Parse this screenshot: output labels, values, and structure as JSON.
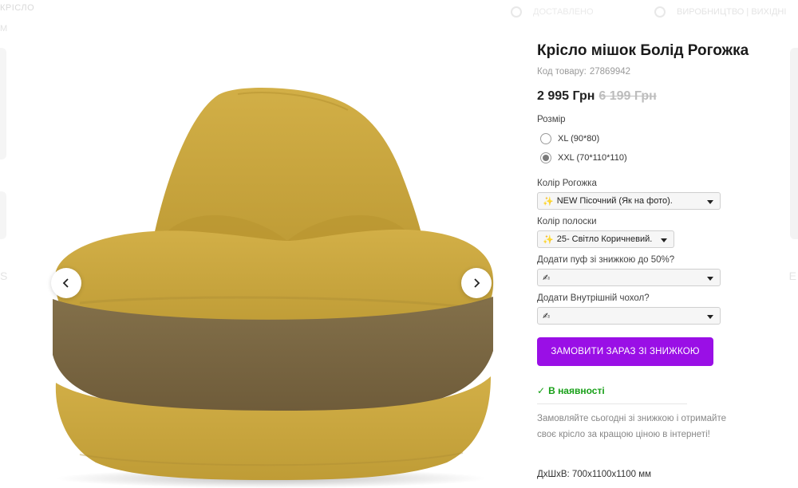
{
  "background": {
    "top_left": "КРІСЛО",
    "top_left_2": "М",
    "top_mid": "ДОСТАВЛЕНО",
    "top_right": "ВИРОБНИЦТВО | ВИХІДНІ",
    "side_left": "S",
    "side_right": "Е"
  },
  "product": {
    "title": "Крісло мішок Болід Рогожка",
    "sku_label": "Код товару:",
    "sku": "27869942",
    "price": "2 995 Грн",
    "old_price": "6 199 Грн",
    "size_label": "Розмір",
    "sizes": [
      {
        "label": "XL (90*80)",
        "checked": false
      },
      {
        "label": "XXL (70*110*110)",
        "checked": true
      }
    ],
    "color_label": "Колір Рогожка",
    "color_value": "NEW Пісочний (Як на фото).",
    "stripe_label": "Колір полоски",
    "stripe_value": "25- Світло Коричневий.",
    "pouf_label": "Додати пуф зі знижкою до 50%?",
    "pouf_value": "✍",
    "cover_label": "Додати Внутрішній чохол?",
    "cover_value": "✍",
    "order_button": "ЗАМОВИТИ ЗАРАЗ ЗІ ЗНИЖКОЮ",
    "stock": "В наявності",
    "stock_check": "✓",
    "promo": "Замовляйте сьогодні зі знижкою і отримайте своє крісло за кращою ціною в інтернеті!",
    "dims": "ДхШхВ: 700х1100х1100 мм"
  },
  "gallery": {
    "sparkle_icon": "✨",
    "prev_icon": "chevron-left",
    "next_icon": "chevron-right"
  },
  "colors": {
    "accent": "#9a0fe6",
    "stock": "#18a018",
    "chair_main": "#c9a63e",
    "chair_stripe": "#7d6841"
  }
}
